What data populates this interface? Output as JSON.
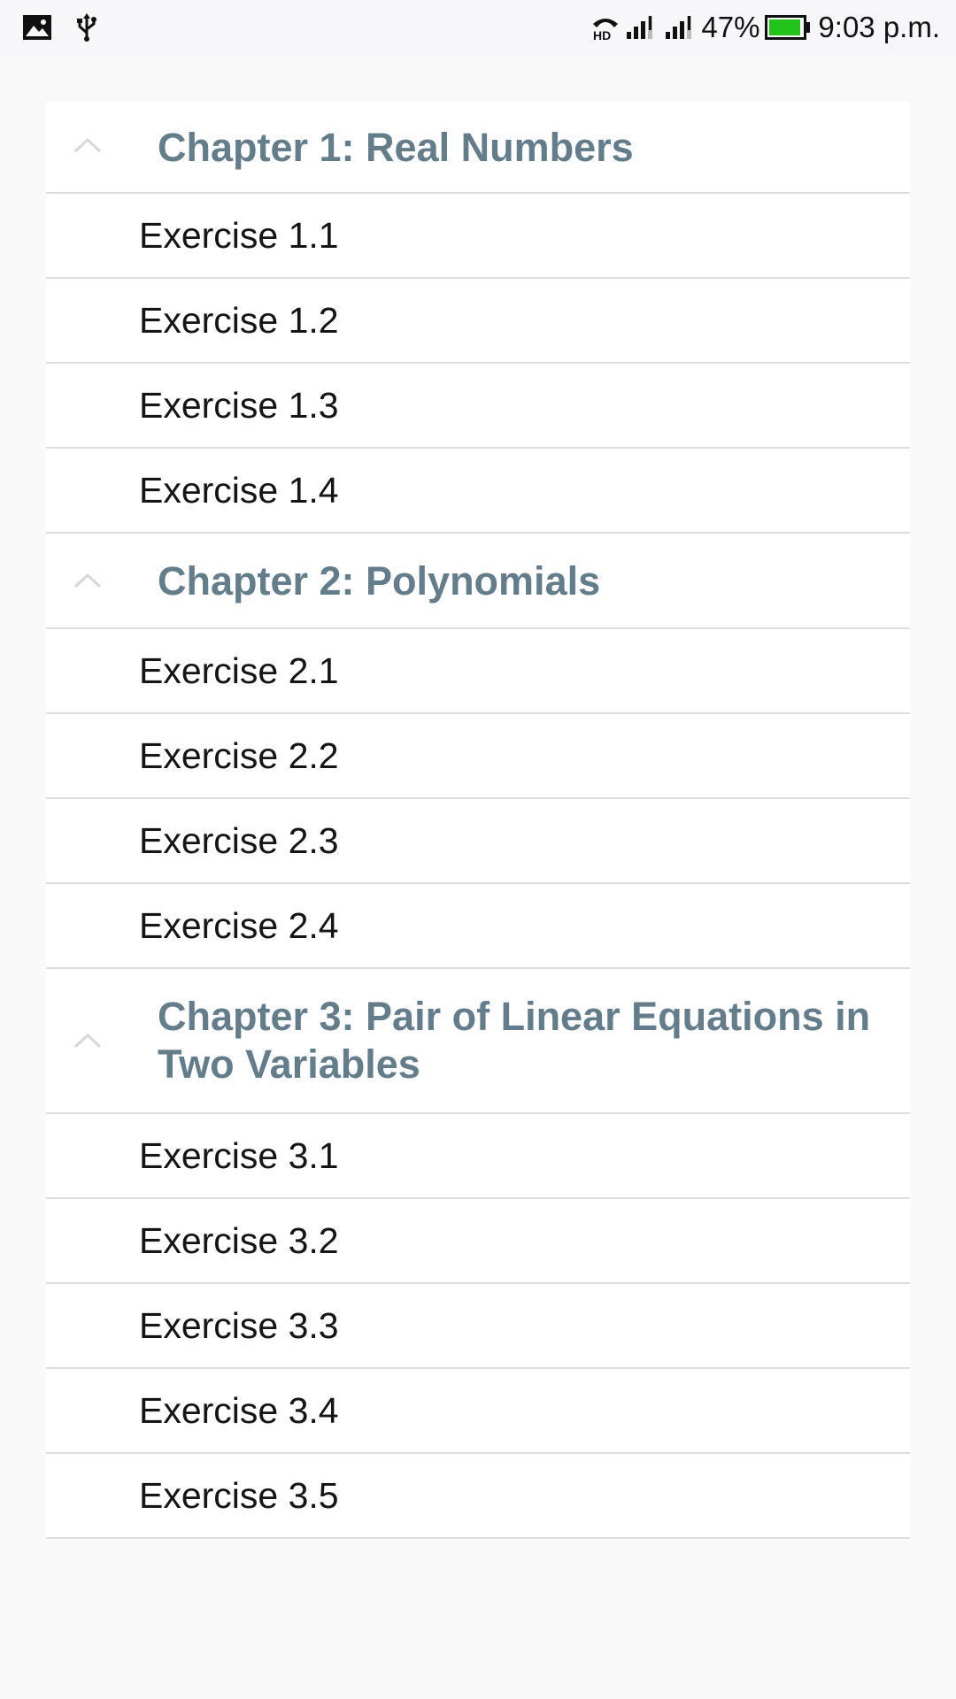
{
  "status_bar": {
    "left_icons": [
      "image-icon",
      "usb-icon"
    ],
    "right_icons": [
      "hd-call-icon",
      "signal-1-icon",
      "signal-2-icon",
      "battery-icon"
    ],
    "battery_percent": "47%",
    "battery_level": 0.47,
    "battery_color": "#22c41a",
    "time": "9:03 p.m."
  },
  "colors": {
    "chapter_title": "#637d8a",
    "exercise_text": "#151515",
    "divider": "#dedede",
    "background": "#f9f9f9",
    "list_background": "#ffffff"
  },
  "chapters": [
    {
      "icon": "chevron-up-icon",
      "title": "Chapter 1: Real Numbers",
      "exercises": [
        "Exercise 1.1",
        "Exercise 1.2",
        "Exercise 1.3",
        "Exercise 1.4"
      ]
    },
    {
      "icon": "chevron-up-icon",
      "title": "Chapter 2: Polynomials",
      "exercises": [
        "Exercise 2.1",
        "Exercise 2.2",
        "Exercise 2.3",
        "Exercise 2.4"
      ]
    },
    {
      "icon": "chevron-up-icon",
      "title": "Chapter 3: Pair of Linear Equations in Two Variables",
      "exercises": [
        "Exercise 3.1",
        "Exercise 3.2",
        "Exercise 3.3",
        "Exercise 3.4",
        "Exercise 3.5"
      ]
    }
  ]
}
